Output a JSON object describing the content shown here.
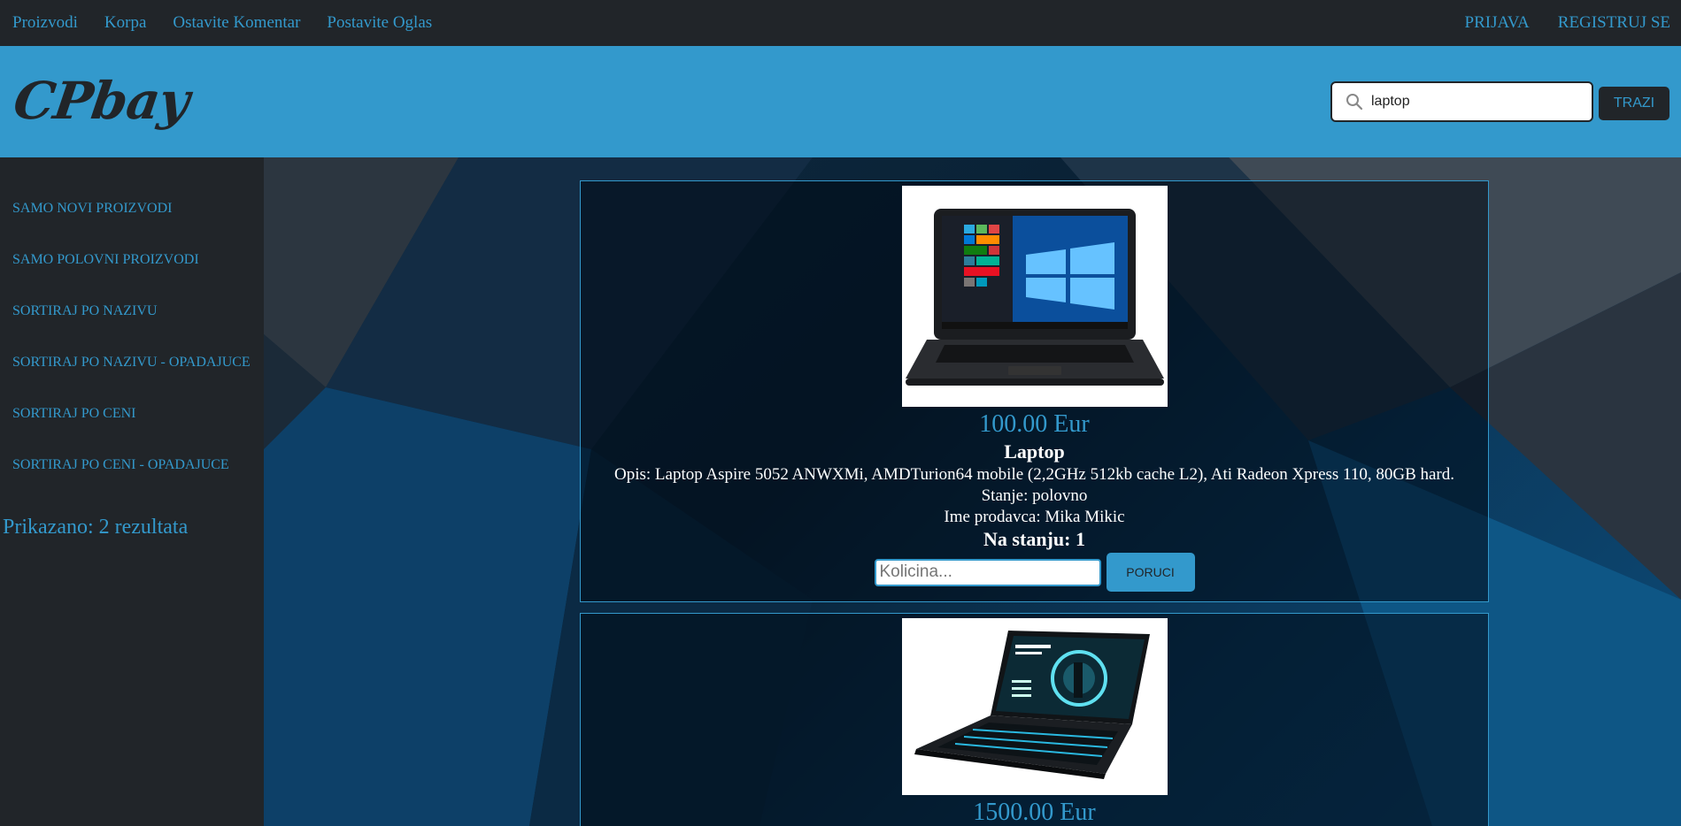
{
  "topnav": {
    "left_links": [
      "Proizvodi",
      "Korpa",
      "Ostavite Komentar",
      "Postavite Oglas"
    ],
    "right_links": [
      "PRIJAVA",
      "REGISTRUJ SE"
    ]
  },
  "header": {
    "logo": "CPbay",
    "search": {
      "value": "laptop",
      "button": "TRAZI"
    }
  },
  "sidebar": {
    "items": [
      "SAMO NOVI PROIZVODI",
      "SAMO POLOVNI PROIZVODI",
      "SORTIRAJ PO NAZIVU",
      "SORTIRAJ PO NAZIVU - OPADAJUCE",
      "SORTIRAJ PO CENI",
      "SORTIRAJ PO CENI - OPADAJUCE"
    ],
    "result_count": "Prikazano: 2 rezultata"
  },
  "products": [
    {
      "price": "100.00 Eur",
      "title": "Laptop",
      "description": "Opis: Laptop Aspire 5052 ANWXMi, AMDTurion64 mobile (2,2GHz 512kb cache L2), Ati Radeon Xpress 110, 80GB hard.",
      "condition": "Stanje: polovno",
      "seller": "Ime prodavca: Mika Mikic",
      "stock": "Na stanju: 1",
      "qty_placeholder": "Kolicina...",
      "order_button": "PORUCI"
    },
    {
      "price": "1500.00 Eur"
    }
  ],
  "colors": {
    "accent": "#3399cc",
    "dark": "#212529"
  },
  "icons": {
    "search": "search-icon"
  }
}
